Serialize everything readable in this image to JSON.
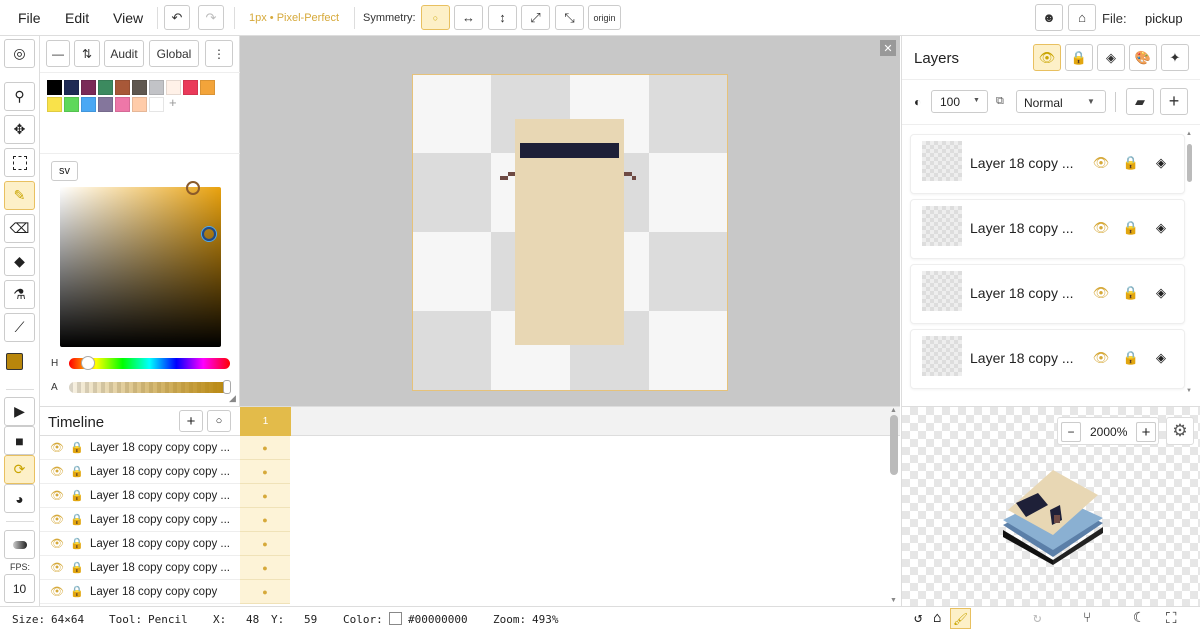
{
  "menu": {
    "file": "File",
    "edit": "Edit",
    "view": "View"
  },
  "toolbar": {
    "brush_info": "1px • Pixel-Perfect",
    "symmetry_label": "Symmetry:",
    "origin_label": "origin",
    "file_label": "File:",
    "file_name": "pickup"
  },
  "color_panel": {
    "audit": "Audit",
    "global": "Global",
    "more": "⋮",
    "mode": "sv",
    "hue_label": "H",
    "alpha_label": "A",
    "palette": [
      "#000000",
      "#1e2a54",
      "#7a2a57",
      "#3c8a5f",
      "#a85838",
      "#5f574f",
      "#c2c3c7",
      "#fff1e8",
      "#ea3a5a",
      "#f3a43a",
      "#f9e24a",
      "#5fd85a",
      "#4aa8f4",
      "#84769c",
      "#ee77a8",
      "#ffccaa",
      "#ffffff"
    ],
    "primary_color": "#b8860b",
    "secondary_color": "#f2be5c"
  },
  "timeline": {
    "title": "Timeline",
    "frame_number": "1",
    "rows": [
      "Layer 18 copy copy copy ...",
      "Layer 18 copy copy copy ...",
      "Layer 18 copy copy copy ...",
      "Layer 18 copy copy copy ...",
      "Layer 18 copy copy copy ...",
      "Layer 18 copy copy copy ...",
      "Layer 18 copy copy copy"
    ]
  },
  "left_tools": {
    "fps_label": "FPS:",
    "fps_value": "10"
  },
  "layers": {
    "title": "Layers",
    "opacity": "100",
    "blend_mode": "Normal",
    "items": [
      "Layer 18 copy ...",
      "Layer 18 copy ...",
      "Layer 18 copy ...",
      "Layer 18 copy ..."
    ]
  },
  "preview": {
    "zoom": "2000%"
  },
  "status": {
    "size_label": "Size:",
    "size_value": "64×64",
    "tool_label": "Tool:",
    "tool_value": "Pencil",
    "x_label": "X:",
    "x_value": "48",
    "y_label": "Y:",
    "y_value": "59",
    "color_label": "Color:",
    "color_value": "#00000000",
    "zoom_label": "Zoom:",
    "zoom_value": "493%"
  },
  "colors": {
    "accent": "#d6a93a",
    "accent_bg": "#fdf0c8",
    "canvas_bg": "#c8c8c8",
    "sprite_fill": "#e8d7b4",
    "sprite_dark": "#1e2038"
  }
}
